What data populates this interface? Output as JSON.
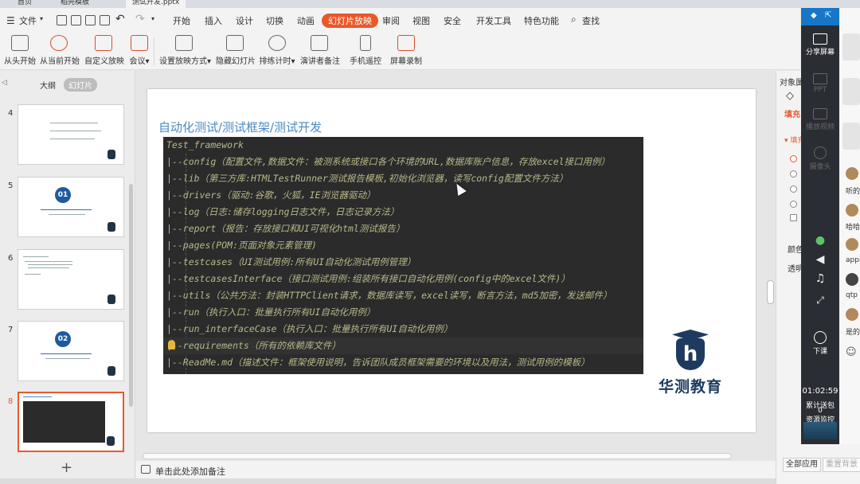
{
  "title_tabs": [
    "首页",
    "稻壳模板",
    "测试开发.pptx"
  ],
  "menu": {
    "file": "文件",
    "tabs": [
      "开始",
      "插入",
      "设计",
      "切换",
      "动画",
      "幻灯片放映",
      "审阅",
      "视图",
      "安全",
      "开发工具",
      "特色功能"
    ],
    "active_tab": "幻灯片放映",
    "search": "查找"
  },
  "ribbon": {
    "buttons": [
      "从头开始",
      "从当前开始",
      "自定义放映",
      "会议",
      "设置放映方式",
      "隐藏幻灯片",
      "排练计时",
      "演讲者备注",
      "手机遥控",
      "屏幕录制"
    ]
  },
  "left_panel": {
    "tab_outline": "大纲",
    "tab_slides": "幻灯片",
    "slide_numbers": [
      "4",
      "5",
      "6",
      "7",
      "8"
    ],
    "badge_5": "01",
    "badge_7": "02",
    "current_slide": "8"
  },
  "slide": {
    "title": "自动化测试/测试框架/测试开发",
    "code_lines": [
      "Test_framework",
      "    |--config（配置文件,数据文件：被测系统或接口各个环境的URL,数据库账户信息，存放excel接口用例）",
      "    |--lib（第三方库:HTMLTestRunner测试报告模板,初始化浏览器，读写config配置文件方法）",
      "    |--drivers（驱动:谷歌，火狐，IE浏览器驱动）",
      "    |--log（日志:储存logging日志文件，日志记录方法）",
      "    |--report（报告：存放接口和UI可视化html测试报告）",
      "    |--pages(POM:页面对象元素管理)",
      "    |--testcases（UI测试用例:所有UI自动化测试用例管理）",
      "    |--testcasesInterface（接口测试用例:组装所有接口自动化用例(config中的excel文件)）",
      "    |--utils（公共方法：封装HTTPClient请求，数据库读写，excel读写，断言方法，md5加密，发送邮件）",
      "    |--run（执行入口：批量执行所有UI自动化用例）",
      "    |--run_interfaceCase（执行入口：批量执行所有UI自动化用例）",
      "    |--requirements（所有的依赖库文件）",
      "    |--ReadMe.md（描述文件：框架使用说明，告诉团队成员框架需要的环境以及用法，测试用例的模板）"
    ],
    "logo_text": "华测教育",
    "logo_mark": "h"
  },
  "notes_placeholder": "单击此处添加备注",
  "right_panel": {
    "header": "对象属",
    "tab_fill": "填充",
    "section_fill": "▾ 填充",
    "label_color": "颜色",
    "label_transparency": "透明",
    "btn_apply_all": "全部应用",
    "btn_reset": "重置背景"
  },
  "meeting": {
    "share": "分享屏幕",
    "ppt": "PPT",
    "video": "播放视频",
    "camera": "摄像头",
    "end": "下课",
    "time": "01:02:59",
    "gift_label": "累计送包",
    "gift_count": "0",
    "resource": "资源监控"
  },
  "chat": {
    "messages": [
      "听的",
      "哈哈",
      "appi",
      "qtp",
      "是的"
    ]
  }
}
